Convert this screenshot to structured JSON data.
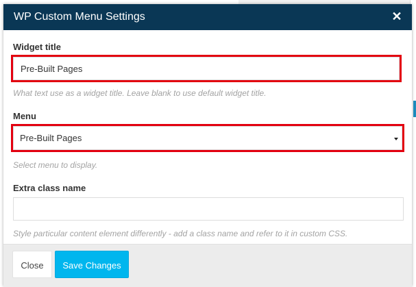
{
  "modal": {
    "title": "WP Custom Menu Settings",
    "close_icon": "close-icon"
  },
  "fields": {
    "widget_title": {
      "label": "Widget title",
      "value": "Pre-Built Pages",
      "description": "What text use as a widget title. Leave blank to use default widget title."
    },
    "menu": {
      "label": "Menu",
      "selected": "Pre-Built Pages",
      "description": "Select menu to display."
    },
    "extra_class": {
      "label": "Extra class name",
      "value": "",
      "description": "Style particular content element differently - add a class name and refer to it in custom CSS."
    }
  },
  "footer": {
    "close_label": "Close",
    "save_label": "Save Changes"
  },
  "colors": {
    "header": "#0a3755",
    "save_button": "#00b6ee",
    "highlight": "#e3000f"
  }
}
